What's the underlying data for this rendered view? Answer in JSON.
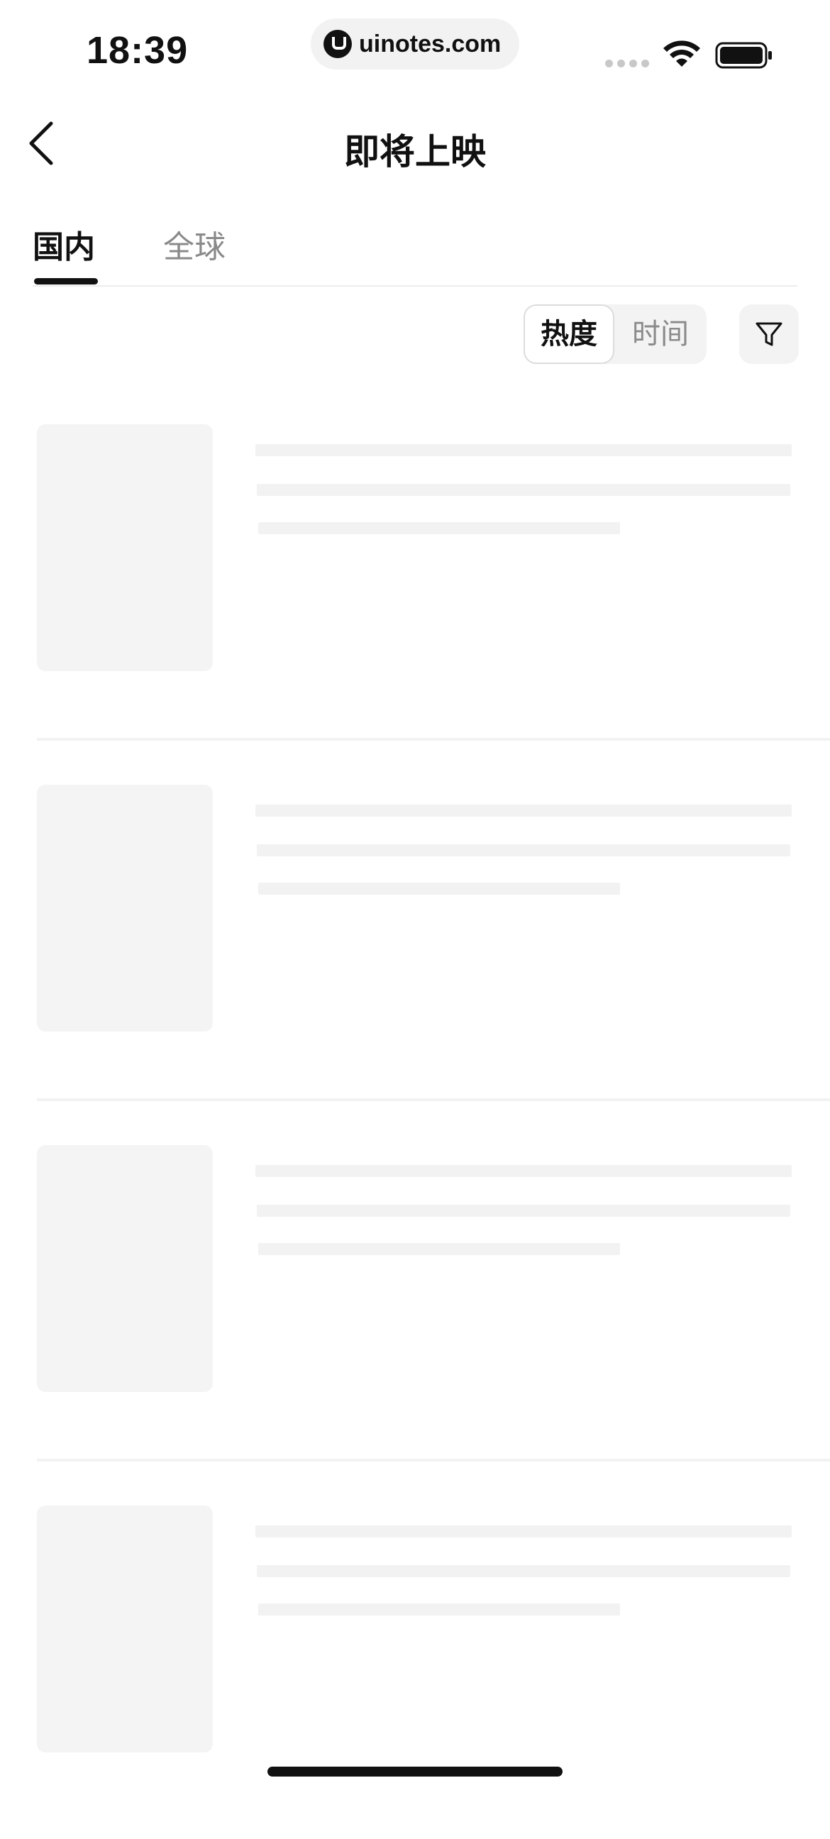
{
  "status_bar": {
    "time": "18:39",
    "url": "uinotes.com",
    "icons": [
      "signal-icon",
      "wifi-icon",
      "battery-icon"
    ]
  },
  "nav": {
    "back_icon": "chevron-left-icon",
    "title": "即将上映"
  },
  "tabs": [
    {
      "label": "国内",
      "active": true
    },
    {
      "label": "全球",
      "active": false
    }
  ],
  "sort": {
    "options": [
      {
        "label": "热度",
        "active": true
      },
      {
        "label": "时间",
        "active": false
      }
    ],
    "filter_icon": "filter-icon"
  },
  "list": {
    "state": "loading",
    "skeleton_count": 4
  },
  "colors": {
    "text_primary": "#111111",
    "text_secondary": "#8a8a8a",
    "skeleton": "#f3f3f3",
    "background": "#ffffff"
  }
}
